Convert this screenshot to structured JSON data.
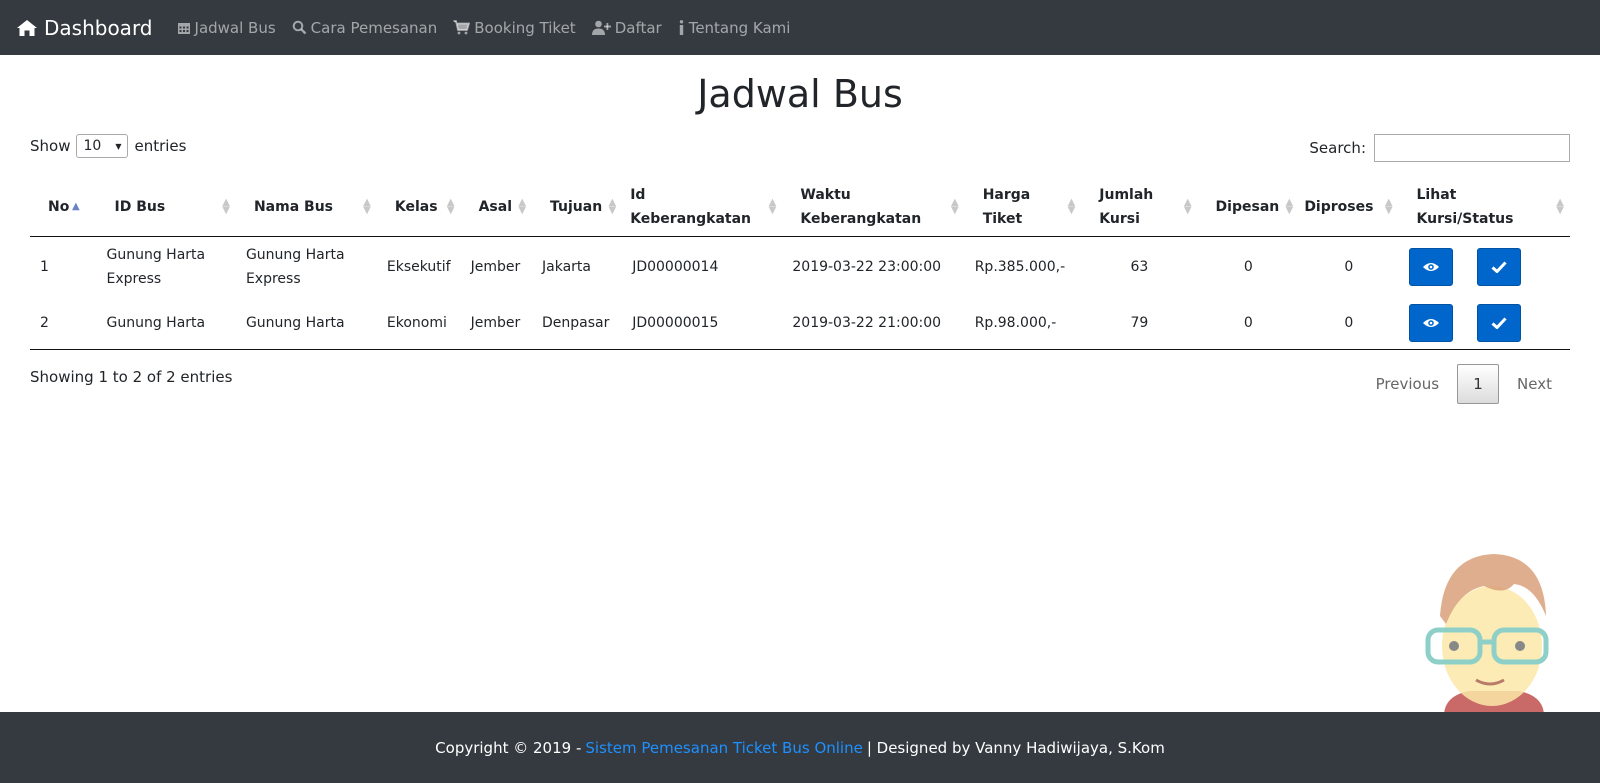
{
  "nav": {
    "brand": "Dashboard",
    "items": [
      {
        "label": "Jadwal Bus",
        "icon": "calendar-icon"
      },
      {
        "label": "Cara Pemesanan",
        "icon": "search-icon"
      },
      {
        "label": "Booking Tiket",
        "icon": "shopping-cart-icon"
      },
      {
        "label": "Daftar",
        "icon": "user-plus-icon"
      },
      {
        "label": "Tentang Kami",
        "icon": "info-icon"
      }
    ]
  },
  "page": {
    "title": "Jadwal Bus"
  },
  "controls": {
    "show_label": "Show",
    "entries_value": "10",
    "entries_label": "entries",
    "search_label": "Search:",
    "search_value": ""
  },
  "table": {
    "headers": [
      "No",
      "ID Bus",
      "Nama Bus",
      "Kelas",
      "Asal",
      "Tujuan",
      "Id Keberangkatan",
      "Waktu Keberangkatan",
      "Harga Tiket",
      "Jumlah Kursi",
      "Dipesan",
      "Diproses",
      "Lihat Kursi/Status"
    ],
    "rows": [
      {
        "no": "1",
        "id_bus": "Gunung Harta Express",
        "nama_bus": "Gunung Harta Express",
        "kelas": "Eksekutif",
        "asal": "Jember",
        "tujuan": "Jakarta",
        "id_keberangkatan": "JD00000014",
        "waktu": "2019-03-22 23:00:00",
        "harga": "Rp.385.000,-",
        "jumlah_kursi": "63",
        "dipesan": "0",
        "diproses": "0"
      },
      {
        "no": "2",
        "id_bus": "Gunung Harta",
        "nama_bus": "Gunung Harta",
        "kelas": "Ekonomi",
        "asal": "Jember",
        "tujuan": "Denpasar",
        "id_keberangkatan": "JD00000015",
        "waktu": "2019-03-22 21:00:00",
        "harga": "Rp.98.000,-",
        "jumlah_kursi": "79",
        "dipesan": "0",
        "diproses": "0"
      }
    ]
  },
  "footer_info": "Showing 1 to 2 of 2 entries",
  "pagination": {
    "previous": "Previous",
    "current": "1",
    "next": "Next"
  },
  "footer": {
    "prefix": "Copyright © 2019 -",
    "link": "Sistem Pemesanan Ticket Bus Online",
    "suffix": "| Designed by Vanny Hadiwijaya, S.Kom"
  },
  "colors": {
    "navbar": "#343a40",
    "action_button": "#0066cc",
    "footer_link": "#1e90ff"
  }
}
